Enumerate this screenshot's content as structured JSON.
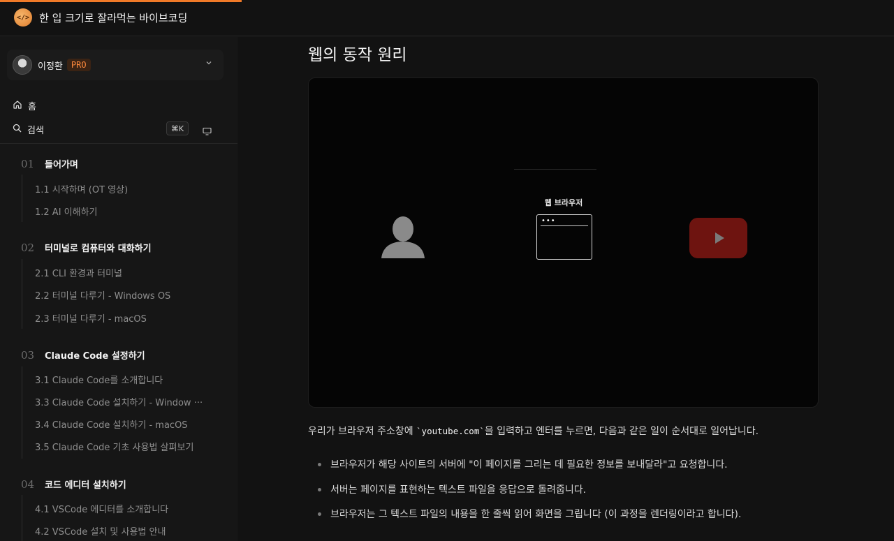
{
  "header": {
    "logo_text": "</>",
    "title": "한 입 크기로 잘라먹는 바이브코딩",
    "progress_percent": 27
  },
  "sidebar": {
    "user": {
      "name": "이정환",
      "badge": "PRO"
    },
    "home_label": "홈",
    "search_label": "검색",
    "search_shortcut": "⌘K",
    "sections": [
      {
        "num": "01",
        "title": "들어가며",
        "lessons": [
          "1.1 시작하며 (OT 영상)",
          "1.2 AI 이해하기"
        ]
      },
      {
        "num": "02",
        "title": "터미널로 컴퓨터와 대화하기",
        "lessons": [
          "2.1 CLI 환경과 터미널",
          "2.2 터미널 다루기 - Windows OS",
          "2.3 터미널 다루기 - macOS"
        ]
      },
      {
        "num": "03",
        "title": "Claude Code 설정하기",
        "lessons": [
          "3.1 Claude Code를 소개합니다",
          "3.3 Claude Code 설치하기 - Window ···",
          "3.4 Claude Code 설치하기 - macOS",
          "3.5 Claude Code 기초 사용법 살펴보기"
        ]
      },
      {
        "num": "04",
        "title": "코드 에디터 설치하기",
        "lessons": [
          "4.1 VSCode 에디터를 소개합니다",
          "4.2 VSCode 설치 및 사용법 안내"
        ]
      }
    ]
  },
  "main": {
    "title": "웹의 동작 원리",
    "video": {
      "browser_label": "웹 브라우저",
      "browser_dots": "•••"
    },
    "intro_before": "우리가 브라우저 주소창에 ",
    "intro_code": "`youtube.com`",
    "intro_after": "을 입력하고 엔터를 누르면, 다음과 같은 일이 순서대로 일어납니다.",
    "bullets": [
      "브라우저가 해당 사이트의 서버에 \"이 페이지를 그리는 데 필요한 정보를 보내달라\"고 요청합니다.",
      "서버는 페이지를 표현하는 텍스트 파일을 응답으로 돌려줍니다.",
      "브라우저는 그 텍스트 파일의 내용을 한 줄씩 읽어 화면을 그립니다 (이 과정을 렌더링이라고 합니다)."
    ]
  }
}
